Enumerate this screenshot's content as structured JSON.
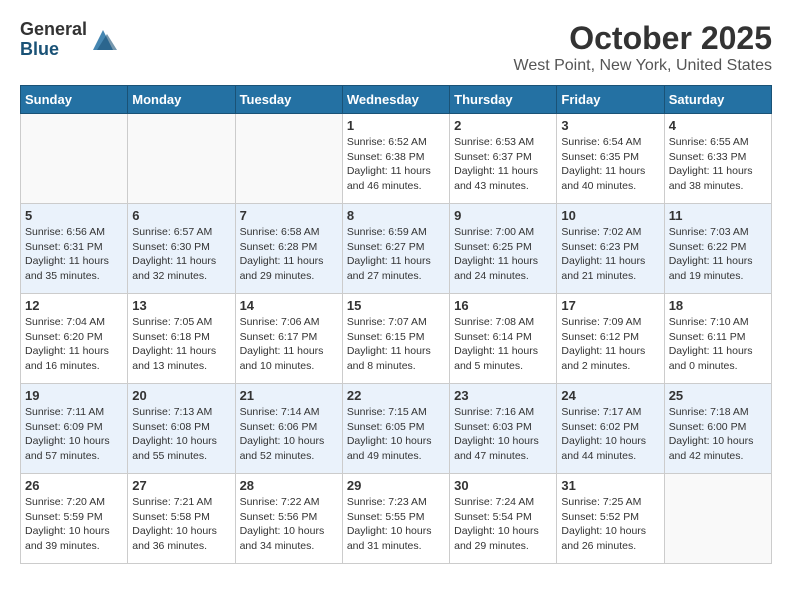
{
  "header": {
    "logo_general": "General",
    "logo_blue": "Blue",
    "month_title": "October 2025",
    "location": "West Point, New York, United States"
  },
  "weekdays": [
    "Sunday",
    "Monday",
    "Tuesday",
    "Wednesday",
    "Thursday",
    "Friday",
    "Saturday"
  ],
  "weeks": [
    [
      {
        "day": "",
        "info": ""
      },
      {
        "day": "",
        "info": ""
      },
      {
        "day": "",
        "info": ""
      },
      {
        "day": "1",
        "info": "Sunrise: 6:52 AM\nSunset: 6:38 PM\nDaylight: 11 hours\nand 46 minutes."
      },
      {
        "day": "2",
        "info": "Sunrise: 6:53 AM\nSunset: 6:37 PM\nDaylight: 11 hours\nand 43 minutes."
      },
      {
        "day": "3",
        "info": "Sunrise: 6:54 AM\nSunset: 6:35 PM\nDaylight: 11 hours\nand 40 minutes."
      },
      {
        "day": "4",
        "info": "Sunrise: 6:55 AM\nSunset: 6:33 PM\nDaylight: 11 hours\nand 38 minutes."
      }
    ],
    [
      {
        "day": "5",
        "info": "Sunrise: 6:56 AM\nSunset: 6:31 PM\nDaylight: 11 hours\nand 35 minutes."
      },
      {
        "day": "6",
        "info": "Sunrise: 6:57 AM\nSunset: 6:30 PM\nDaylight: 11 hours\nand 32 minutes."
      },
      {
        "day": "7",
        "info": "Sunrise: 6:58 AM\nSunset: 6:28 PM\nDaylight: 11 hours\nand 29 minutes."
      },
      {
        "day": "8",
        "info": "Sunrise: 6:59 AM\nSunset: 6:27 PM\nDaylight: 11 hours\nand 27 minutes."
      },
      {
        "day": "9",
        "info": "Sunrise: 7:00 AM\nSunset: 6:25 PM\nDaylight: 11 hours\nand 24 minutes."
      },
      {
        "day": "10",
        "info": "Sunrise: 7:02 AM\nSunset: 6:23 PM\nDaylight: 11 hours\nand 21 minutes."
      },
      {
        "day": "11",
        "info": "Sunrise: 7:03 AM\nSunset: 6:22 PM\nDaylight: 11 hours\nand 19 minutes."
      }
    ],
    [
      {
        "day": "12",
        "info": "Sunrise: 7:04 AM\nSunset: 6:20 PM\nDaylight: 11 hours\nand 16 minutes."
      },
      {
        "day": "13",
        "info": "Sunrise: 7:05 AM\nSunset: 6:18 PM\nDaylight: 11 hours\nand 13 minutes."
      },
      {
        "day": "14",
        "info": "Sunrise: 7:06 AM\nSunset: 6:17 PM\nDaylight: 11 hours\nand 10 minutes."
      },
      {
        "day": "15",
        "info": "Sunrise: 7:07 AM\nSunset: 6:15 PM\nDaylight: 11 hours\nand 8 minutes."
      },
      {
        "day": "16",
        "info": "Sunrise: 7:08 AM\nSunset: 6:14 PM\nDaylight: 11 hours\nand 5 minutes."
      },
      {
        "day": "17",
        "info": "Sunrise: 7:09 AM\nSunset: 6:12 PM\nDaylight: 11 hours\nand 2 minutes."
      },
      {
        "day": "18",
        "info": "Sunrise: 7:10 AM\nSunset: 6:11 PM\nDaylight: 11 hours\nand 0 minutes."
      }
    ],
    [
      {
        "day": "19",
        "info": "Sunrise: 7:11 AM\nSunset: 6:09 PM\nDaylight: 10 hours\nand 57 minutes."
      },
      {
        "day": "20",
        "info": "Sunrise: 7:13 AM\nSunset: 6:08 PM\nDaylight: 10 hours\nand 55 minutes."
      },
      {
        "day": "21",
        "info": "Sunrise: 7:14 AM\nSunset: 6:06 PM\nDaylight: 10 hours\nand 52 minutes."
      },
      {
        "day": "22",
        "info": "Sunrise: 7:15 AM\nSunset: 6:05 PM\nDaylight: 10 hours\nand 49 minutes."
      },
      {
        "day": "23",
        "info": "Sunrise: 7:16 AM\nSunset: 6:03 PM\nDaylight: 10 hours\nand 47 minutes."
      },
      {
        "day": "24",
        "info": "Sunrise: 7:17 AM\nSunset: 6:02 PM\nDaylight: 10 hours\nand 44 minutes."
      },
      {
        "day": "25",
        "info": "Sunrise: 7:18 AM\nSunset: 6:00 PM\nDaylight: 10 hours\nand 42 minutes."
      }
    ],
    [
      {
        "day": "26",
        "info": "Sunrise: 7:20 AM\nSunset: 5:59 PM\nDaylight: 10 hours\nand 39 minutes."
      },
      {
        "day": "27",
        "info": "Sunrise: 7:21 AM\nSunset: 5:58 PM\nDaylight: 10 hours\nand 36 minutes."
      },
      {
        "day": "28",
        "info": "Sunrise: 7:22 AM\nSunset: 5:56 PM\nDaylight: 10 hours\nand 34 minutes."
      },
      {
        "day": "29",
        "info": "Sunrise: 7:23 AM\nSunset: 5:55 PM\nDaylight: 10 hours\nand 31 minutes."
      },
      {
        "day": "30",
        "info": "Sunrise: 7:24 AM\nSunset: 5:54 PM\nDaylight: 10 hours\nand 29 minutes."
      },
      {
        "day": "31",
        "info": "Sunrise: 7:25 AM\nSunset: 5:52 PM\nDaylight: 10 hours\nand 26 minutes."
      },
      {
        "day": "",
        "info": ""
      }
    ]
  ]
}
